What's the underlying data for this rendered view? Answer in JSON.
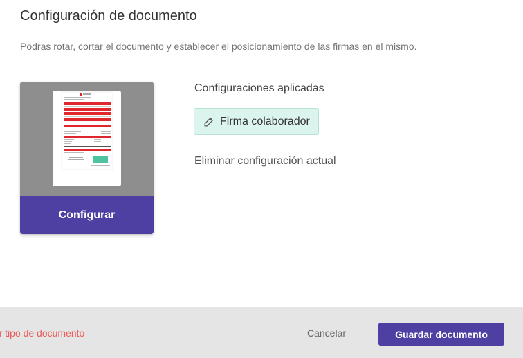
{
  "dialog": {
    "title": "Configuración de documento",
    "subtitle": "Podras rotar, cortar el documento y establecer el posicionamiento de las firmas en el mismo."
  },
  "preview": {
    "configure_label": "Configurar"
  },
  "applied": {
    "heading": "Configuraciones aplicadas",
    "tags": [
      {
        "label": "Firma colaborador",
        "icon": "edit-icon"
      }
    ],
    "remove_label": "Eliminar configuración actual"
  },
  "footer": {
    "left_link_label": "nar tipo de documento",
    "cancel_label": "Cancelar",
    "save_label": "Guardar documento"
  },
  "colors": {
    "primary": "#4e3fa3",
    "danger": "#ec5c5c",
    "tag_bg": "#dcf4ee"
  }
}
